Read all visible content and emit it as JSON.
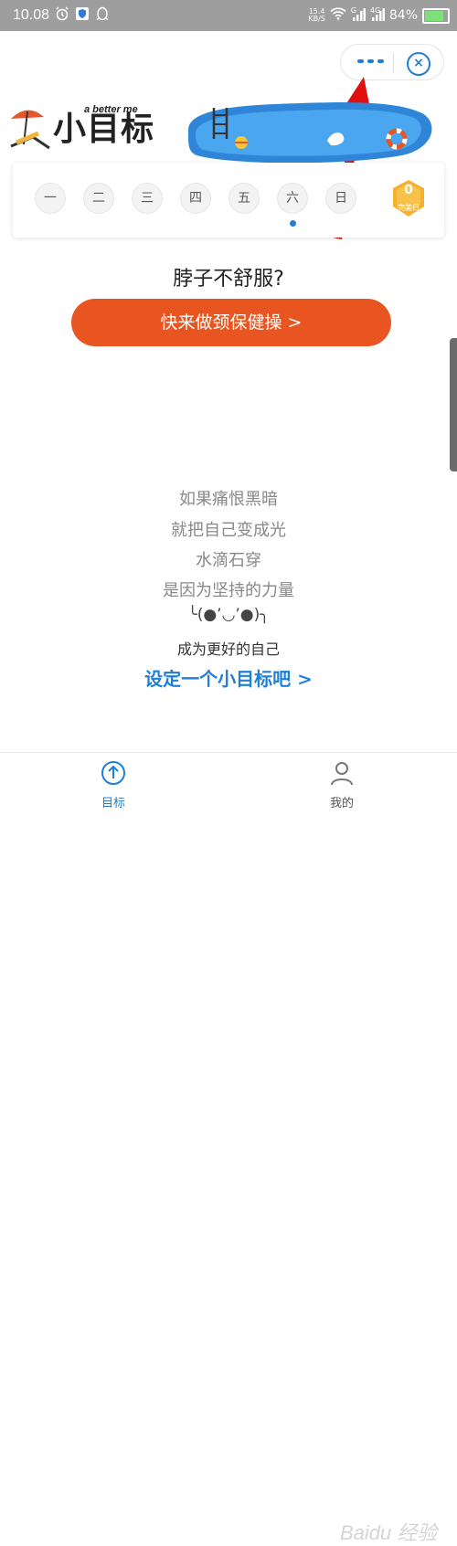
{
  "status_bar": {
    "time": "10.08",
    "net_speed_value": "15.4",
    "net_speed_unit": "KB/S",
    "battery": "84%",
    "network_labels": [
      "G",
      "4G"
    ]
  },
  "capsule": {
    "more_icon": "more-dots-icon",
    "close_icon": "close-circle-icon"
  },
  "banner": {
    "title": "小目标",
    "subtitle": "a better me"
  },
  "week": {
    "days": [
      "一",
      "二",
      "三",
      "四",
      "五",
      "六",
      "日"
    ],
    "selected_index": 5,
    "badge_count": "0",
    "badge_label": "完美日"
  },
  "promo": {
    "question": "脖子不舒服?",
    "button_label": "快来做颈保健操 >"
  },
  "quotes": [
    "如果痛恨黑暗",
    "就把自己变成光",
    "水滴石穿",
    "是因为坚持的力量"
  ],
  "emoticon": "╰(●’◡’●)╮",
  "better_self": "成为更好的自己",
  "set_goal_link": "设定一个小目标吧 >",
  "tabs": [
    {
      "label": "目标",
      "icon": "arrow-up-circle-icon",
      "active": true
    },
    {
      "label": "我的",
      "icon": "user-icon",
      "active": false
    }
  ],
  "watermark": "Baidu 经验",
  "colors": {
    "accent": "#1f7fd6",
    "cta": "#e85520",
    "status_bar": "#9e9e9e"
  }
}
